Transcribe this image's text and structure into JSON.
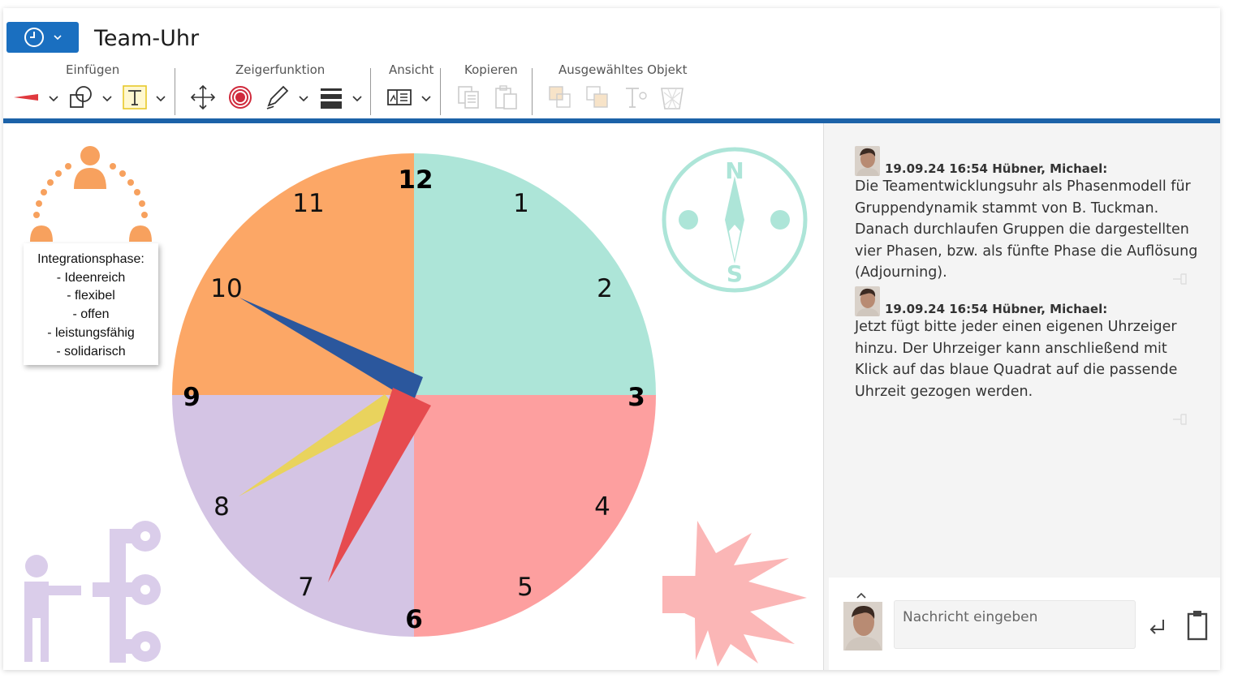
{
  "app": {
    "title": "Team-Uhr"
  },
  "toolbar": {
    "groups": {
      "insert": "Einfügen",
      "pointer": "Zeigerfunktion",
      "view": "Ansicht",
      "copy": "Kopieren",
      "selected": "Ausgewähltes Objekt"
    }
  },
  "clock": {
    "numbers": [
      "12",
      "1",
      "2",
      "3",
      "4",
      "5",
      "6",
      "7",
      "8",
      "9",
      "10",
      "11"
    ],
    "quadrant_colors": {
      "top_right": "#ade5d8",
      "bottom_right": "#fd9f9f",
      "bottom_left": "#d4c4e4",
      "top_left": "#fca766"
    }
  },
  "tooltip": {
    "lines": [
      "Integrationsphase:",
      "- Ideenreich",
      "- flexibel",
      "- offen",
      "- leistungsfähig",
      "- solidarisch"
    ]
  },
  "chat": {
    "messages": [
      {
        "header": "19.09.24 16:54 Hübner, Michael:",
        "text": "Die Teamentwicklungsuhr als Phasenmodell für Gruppendynamik stammt von B. Tuckman. Danach durchlaufen Gruppen die dargestellten vier Phasen, bzw. als fünfte Phase die Auflösung (Adjourning)."
      },
      {
        "header": "19.09.24 16:54 Hübner, Michael:",
        "text": "Jetzt fügt bitte jeder einen eigenen Uhrzeiger hinzu. Der Uhrzeiger kann anschließend mit Klick auf das blaue Quadrat auf die passende Uhrzeit gezogen werden."
      }
    ],
    "input_placeholder": "Nachricht eingeben"
  },
  "icons": {
    "app_button": "clock-icon",
    "compass": "compass-icon",
    "team": "team-icon",
    "structure": "org-structure-icon",
    "conflict": "conflict-fist-icon"
  },
  "colors": {
    "accent": "#1a6fc0",
    "bar": "#1c62a8"
  }
}
